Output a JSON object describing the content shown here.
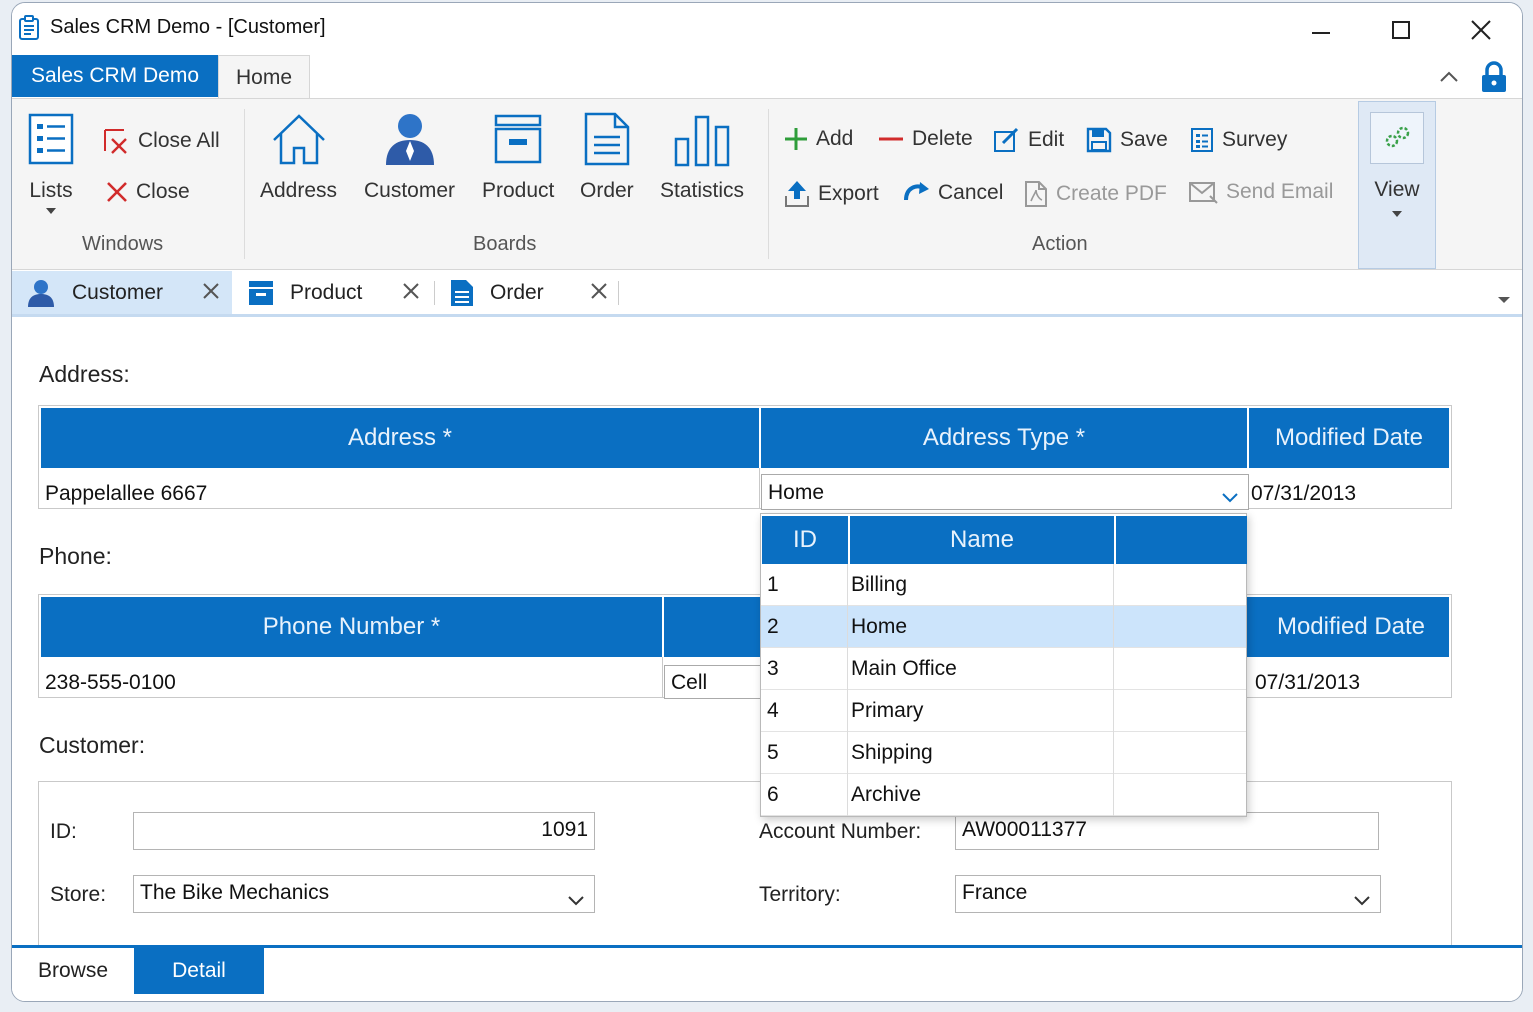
{
  "window": {
    "title": "Sales CRM Demo - [Customer]"
  },
  "colors": {
    "accent": "#0a6fc2",
    "header_text": "#e8f2fc",
    "selected_row": "#cce4fb",
    "add_green": "#2e9d3a",
    "delete_red": "#d12b2b"
  },
  "ribbon": {
    "file_tab": "Sales CRM Demo",
    "home_tab": "Home",
    "windows": {
      "lists": "Lists",
      "close_all": "Close All",
      "close": "Close",
      "group": "Windows"
    },
    "boards": {
      "address": "Address",
      "customer": "Customer",
      "product": "Product",
      "order": "Order",
      "statistics": "Statistics",
      "group": "Boards"
    },
    "action": {
      "add": "Add",
      "delete": "Delete",
      "edit": "Edit",
      "save": "Save",
      "survey": "Survey",
      "export": "Export",
      "cancel": "Cancel",
      "create_pdf": "Create PDF",
      "send_email": "Send Email",
      "group": "Action"
    },
    "view": "View"
  },
  "doc_tabs": [
    {
      "label": "Customer",
      "icon": "customer-icon"
    },
    {
      "label": "Product",
      "icon": "product-icon"
    },
    {
      "label": "Order",
      "icon": "order-icon"
    }
  ],
  "address": {
    "section": "Address:",
    "headers": {
      "address": "Address *",
      "type": "Address Type *",
      "modified": "Modified Date"
    },
    "row": {
      "address": "Pappelallee 6667",
      "type": "Home",
      "modified": "07/31/2013"
    }
  },
  "address_type_dropdown": {
    "headers": {
      "id": "ID",
      "name": "Name"
    },
    "items": [
      {
        "id": "1",
        "name": "Billing"
      },
      {
        "id": "2",
        "name": "Home"
      },
      {
        "id": "3",
        "name": "Main Office"
      },
      {
        "id": "4",
        "name": "Primary"
      },
      {
        "id": "5",
        "name": "Shipping"
      },
      {
        "id": "6",
        "name": "Archive"
      }
    ],
    "selected_id": "2"
  },
  "phone": {
    "section": "Phone:",
    "headers": {
      "number": "Phone Number *",
      "modified": "Modified Date"
    },
    "row": {
      "number": "238-555-0100",
      "type": "Cell",
      "modified": "07/31/2013"
    }
  },
  "customer": {
    "section": "Customer:",
    "id_label": "ID:",
    "id_value": "1091",
    "account_label": "Account Number:",
    "account_value": "AW00011377",
    "store_label": "Store:",
    "store_value": "The Bike Mechanics",
    "territory_label": "Territory:",
    "territory_value": "France"
  },
  "bottom_tabs": {
    "browse": "Browse",
    "detail": "Detail"
  }
}
